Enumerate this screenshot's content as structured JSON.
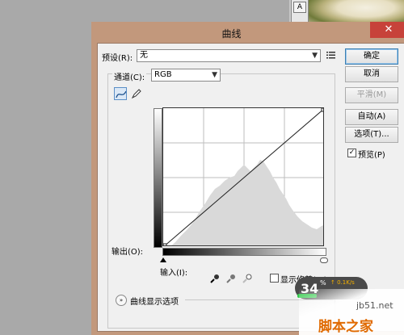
{
  "dialog": {
    "title": "曲线",
    "close_glyph": "✕",
    "preset": {
      "label": "预设(R):",
      "value": "无",
      "menu_icon": "list-menu-icon"
    },
    "channel": {
      "label": "通道(C):",
      "value": "RGB"
    },
    "graph": {
      "output_label": "输出(O):",
      "input_label": "输入(I):",
      "show_clipping_label": "显示修剪(W)",
      "show_clipping_checked": false
    },
    "curve_display_options_label": "曲线显示选项",
    "buttons": {
      "ok": "确定",
      "cancel": "取消",
      "smooth": "平滑(M)",
      "auto": "自动(A)",
      "options": "选项(T)..."
    },
    "preview": {
      "label": "预览(P)",
      "checked": true
    },
    "tools": [
      "curve-point-icon",
      "pencil-icon"
    ],
    "eyedroppers": [
      "black-point-eyedropper-icon",
      "gray-point-eyedropper-icon",
      "white-point-eyedropper-icon"
    ]
  },
  "overlay": {
    "speed_badge": {
      "number": "34",
      "percent": "%",
      "speed": "↑ 0.1K/s"
    }
  },
  "watermark": {
    "site": "jb51.net",
    "title": "脚本之家"
  },
  "colors": {
    "close_button": "#c7423a",
    "dialog_frame": "#c2987c",
    "histogram": "#d9d9d9",
    "primary_button_border": "#3c7fb1"
  }
}
